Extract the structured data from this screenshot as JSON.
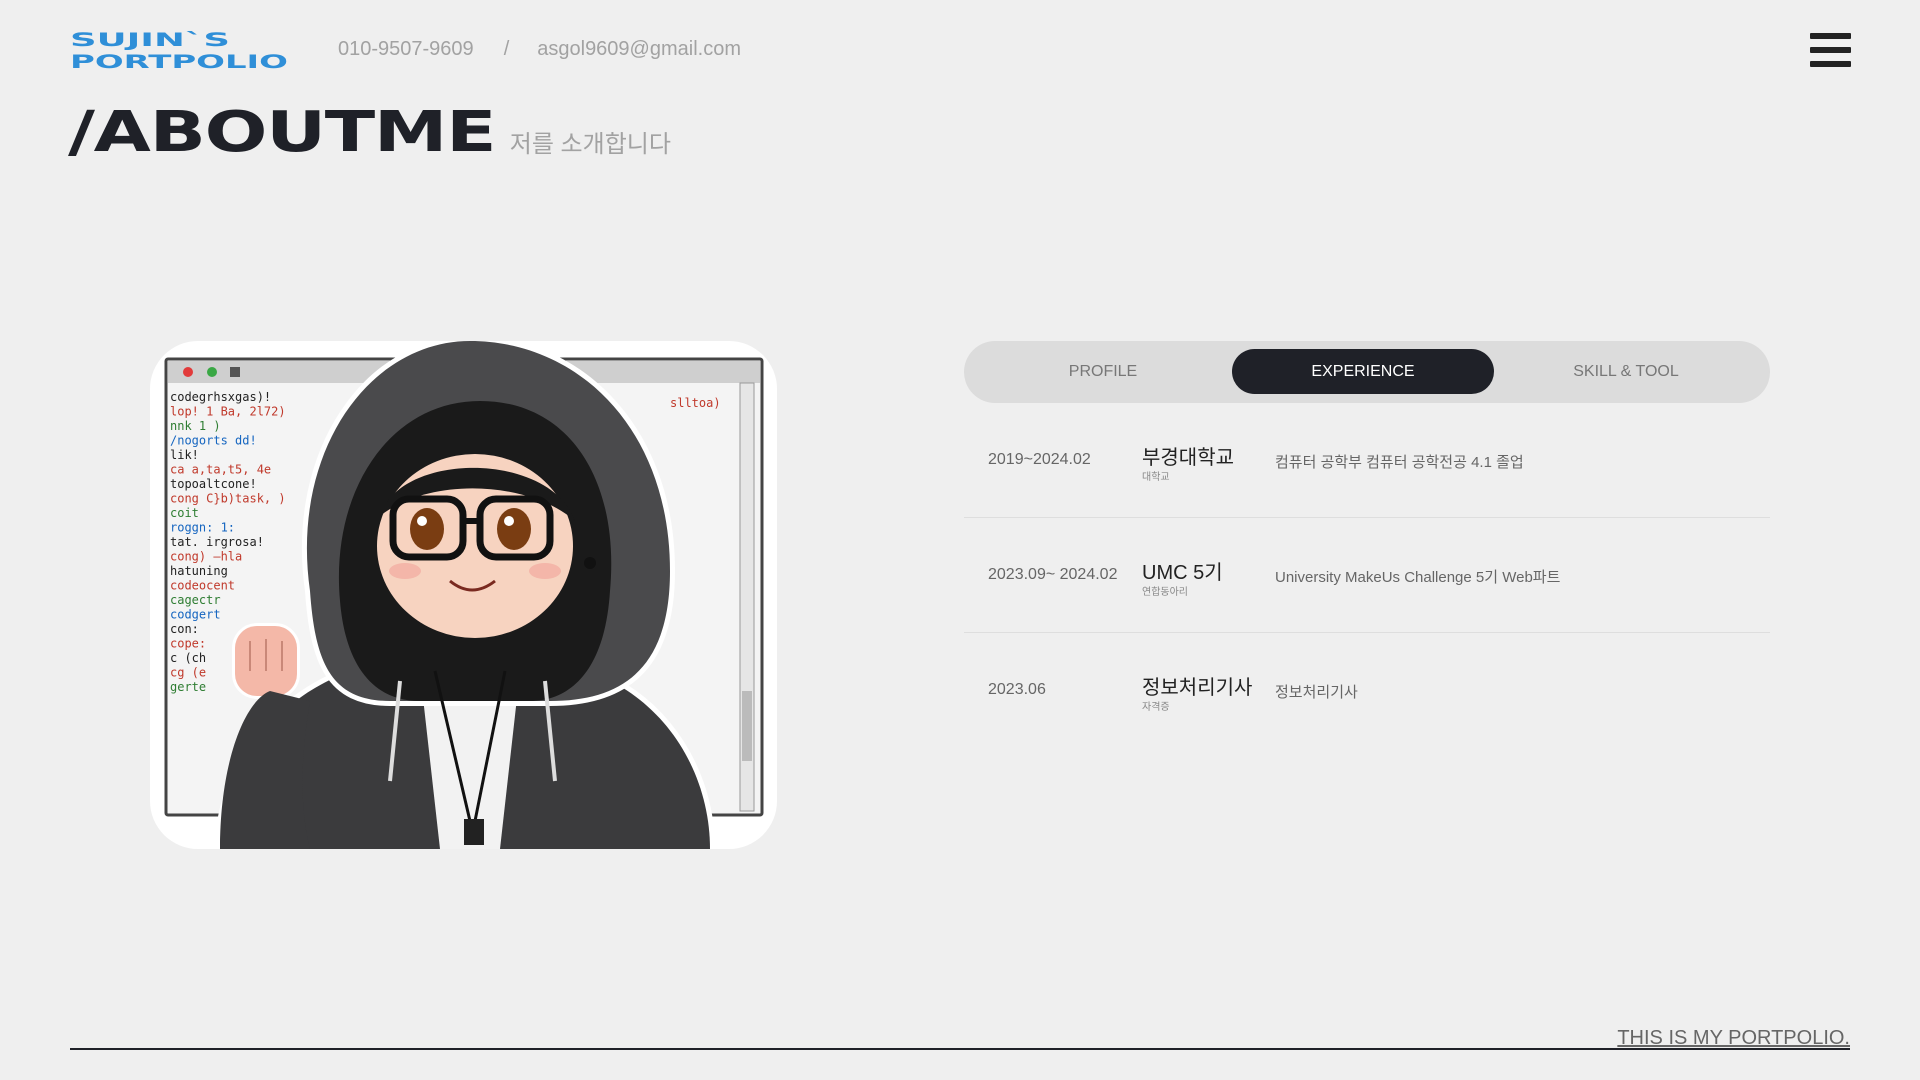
{
  "header": {
    "logo_line1": "SUJIN`S",
    "logo_line2": "PORTPOLIO",
    "phone": "010-9507-9609",
    "separator": "/",
    "email": "asgol9609@gmail.com",
    "menu_icon": "hamburger-menu-icon"
  },
  "section": {
    "title": "/ABOUTME",
    "subtitle": "저를 소개합니다"
  },
  "illustration": {
    "icon": "hooded-girl-illustration",
    "code_lines": [
      "codegrhsxgas)!",
      "lop!  1  Ba, 2l72)",
      "nnk   1  )",
      "/nogorts  dd!",
      "lik!",
      "ca  a,ta,t5, 4e",
      "topoaltcone!",
      "cong  C}b)task, )",
      "coit",
      "roggn:  1:",
      "tat.  irgrosa!",
      "cong) —hla",
      "hatuning",
      "codeocent",
      "cagectr",
      "codgert",
      "con:",
      "cope:",
      "c (ch",
      "cg  (e",
      "gerte"
    ],
    "right_code": "slltoa)"
  },
  "tabs": [
    {
      "label": "PROFILE",
      "active": false
    },
    {
      "label": "EXPERIENCE",
      "active": true
    },
    {
      "label": "SKILL & TOOL",
      "active": false
    }
  ],
  "experience": [
    {
      "date": "2019~2024.02",
      "name": "부경대학교",
      "type": "대학교",
      "desc": "컴퓨터 공학부 컴퓨터 공학전공 4.1 졸업"
    },
    {
      "date": "2023.09~ 2024.02",
      "name": "UMC 5기",
      "type": "연합동아리",
      "desc": "University MakeUs Challenge 5기 Web파트"
    },
    {
      "date": "2023.06",
      "name": "정보처리기사",
      "type": "자격증",
      "desc": "정보처리기사"
    }
  ],
  "footer": {
    "text": "THIS IS MY PORTPOLIO."
  },
  "colors": {
    "background": "#efefef",
    "dark": "#1f2128",
    "logo_blue": "#2f8fd8",
    "muted": "#a2a2a2"
  }
}
